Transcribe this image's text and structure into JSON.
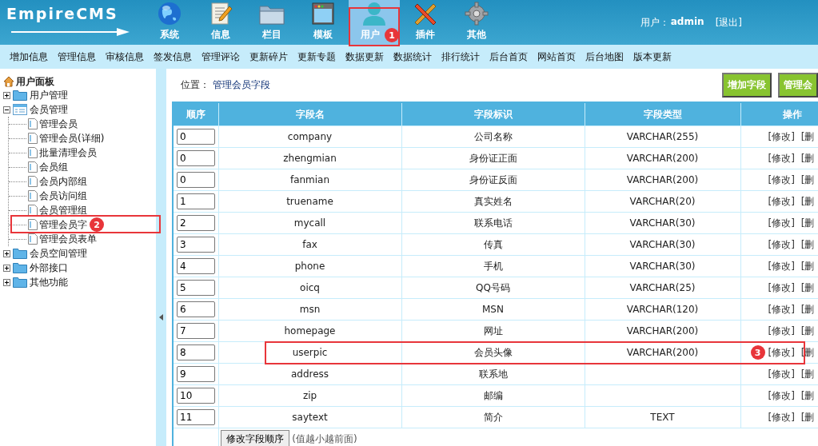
{
  "header": {
    "logo": "EmpireCMS",
    "nav": [
      {
        "label": "系统",
        "selected": false
      },
      {
        "label": "信息",
        "selected": false
      },
      {
        "label": "栏目",
        "selected": false
      },
      {
        "label": "模板",
        "selected": false
      },
      {
        "label": "用户",
        "selected": true,
        "callout": "1"
      },
      {
        "label": "插件",
        "selected": false
      },
      {
        "label": "其他",
        "selected": false
      }
    ],
    "user_label": "用户：",
    "user_name": "admin",
    "logout": "[退出]"
  },
  "menu": [
    "增加信息",
    "管理信息",
    "审核信息",
    "签发信息",
    "管理评论",
    "更新碎片",
    "更新专题",
    "数据更新",
    "数据统计",
    "排行统计",
    "后台首页",
    "网站首页",
    "后台地图",
    "版本更新"
  ],
  "sidebar": {
    "title": "用户面板",
    "items": [
      {
        "label": "用户管理",
        "expanded": false
      },
      {
        "label": "会员管理",
        "expanded": true,
        "children": [
          {
            "label": "管理会员"
          },
          {
            "label": "管理会员(详细)"
          },
          {
            "label": "批量清理会员"
          },
          {
            "label": "会员组"
          },
          {
            "label": "会员内部组"
          },
          {
            "label": "会员访问组"
          },
          {
            "label": "会员管理组"
          },
          {
            "label": "管理会员字",
            "callout": "2"
          },
          {
            "label": "管理会员表单"
          }
        ]
      },
      {
        "label": "会员空间管理",
        "expanded": false
      },
      {
        "label": "外部接口",
        "expanded": false
      },
      {
        "label": "其他功能",
        "expanded": false
      }
    ]
  },
  "location": {
    "label": "位置：",
    "path": "管理会员字段"
  },
  "buttons": [
    "增加字段",
    "管理会"
  ],
  "table": {
    "columns": [
      "顺序",
      "字段名",
      "字段标识",
      "字段类型",
      "操作"
    ],
    "rows": [
      {
        "order": "0",
        "name": "company",
        "title": "公司名称",
        "type": "VARCHAR(255)",
        "edit": "[修改]",
        "delete": "[删"
      },
      {
        "order": "0",
        "name": "zhengmian",
        "title": "身份证正面",
        "type": "VARCHAR(200)",
        "edit": "[修改]",
        "delete": "[删"
      },
      {
        "order": "0",
        "name": "fanmian",
        "title": "身份证反面",
        "type": "VARCHAR(200)",
        "edit": "[修改]",
        "delete": "[删"
      },
      {
        "order": "1",
        "name": "truename",
        "title": "真实姓名",
        "type": "VARCHAR(20)",
        "edit": "[修改]",
        "delete": "[删"
      },
      {
        "order": "2",
        "name": "mycall",
        "title": "联系电话",
        "type": "VARCHAR(30)",
        "edit": "[修改]",
        "delete": "[删"
      },
      {
        "order": "3",
        "name": "fax",
        "title": "传真",
        "type": "VARCHAR(30)",
        "edit": "[修改]",
        "delete": "[删"
      },
      {
        "order": "4",
        "name": "phone",
        "title": "手机",
        "type": "VARCHAR(30)",
        "edit": "[修改]",
        "delete": "[删"
      },
      {
        "order": "5",
        "name": "oicq",
        "title": "QQ号码",
        "type": "VARCHAR(25)",
        "edit": "[修改]",
        "delete": "[删"
      },
      {
        "order": "6",
        "name": "msn",
        "title": "MSN",
        "type": "VARCHAR(120)",
        "edit": "[修改]",
        "delete": "[删"
      },
      {
        "order": "7",
        "name": "homepage",
        "title": "网址",
        "type": "VARCHAR(200)",
        "edit": "[修改]",
        "delete": "[删"
      },
      {
        "order": "8",
        "name": "userpic",
        "title": "会员头像",
        "type": "VARCHAR(200)",
        "edit": "[修改]",
        "delete": "[删",
        "callout": "3"
      },
      {
        "order": "9",
        "name": "address",
        "title": "联系地",
        "edit": "[修改]",
        "delete": "[删"
      },
      {
        "order": "10",
        "name": "zip",
        "title": "邮编",
        "edit": "[修改]",
        "delete": "[删"
      },
      {
        "order": "11",
        "name": "saytext",
        "title": "简介",
        "type": "TEXT",
        "edit": "[修改]",
        "delete": "[删"
      }
    ],
    "save_button": "修改字段顺序",
    "save_hint": "(值越小越前面)"
  }
}
